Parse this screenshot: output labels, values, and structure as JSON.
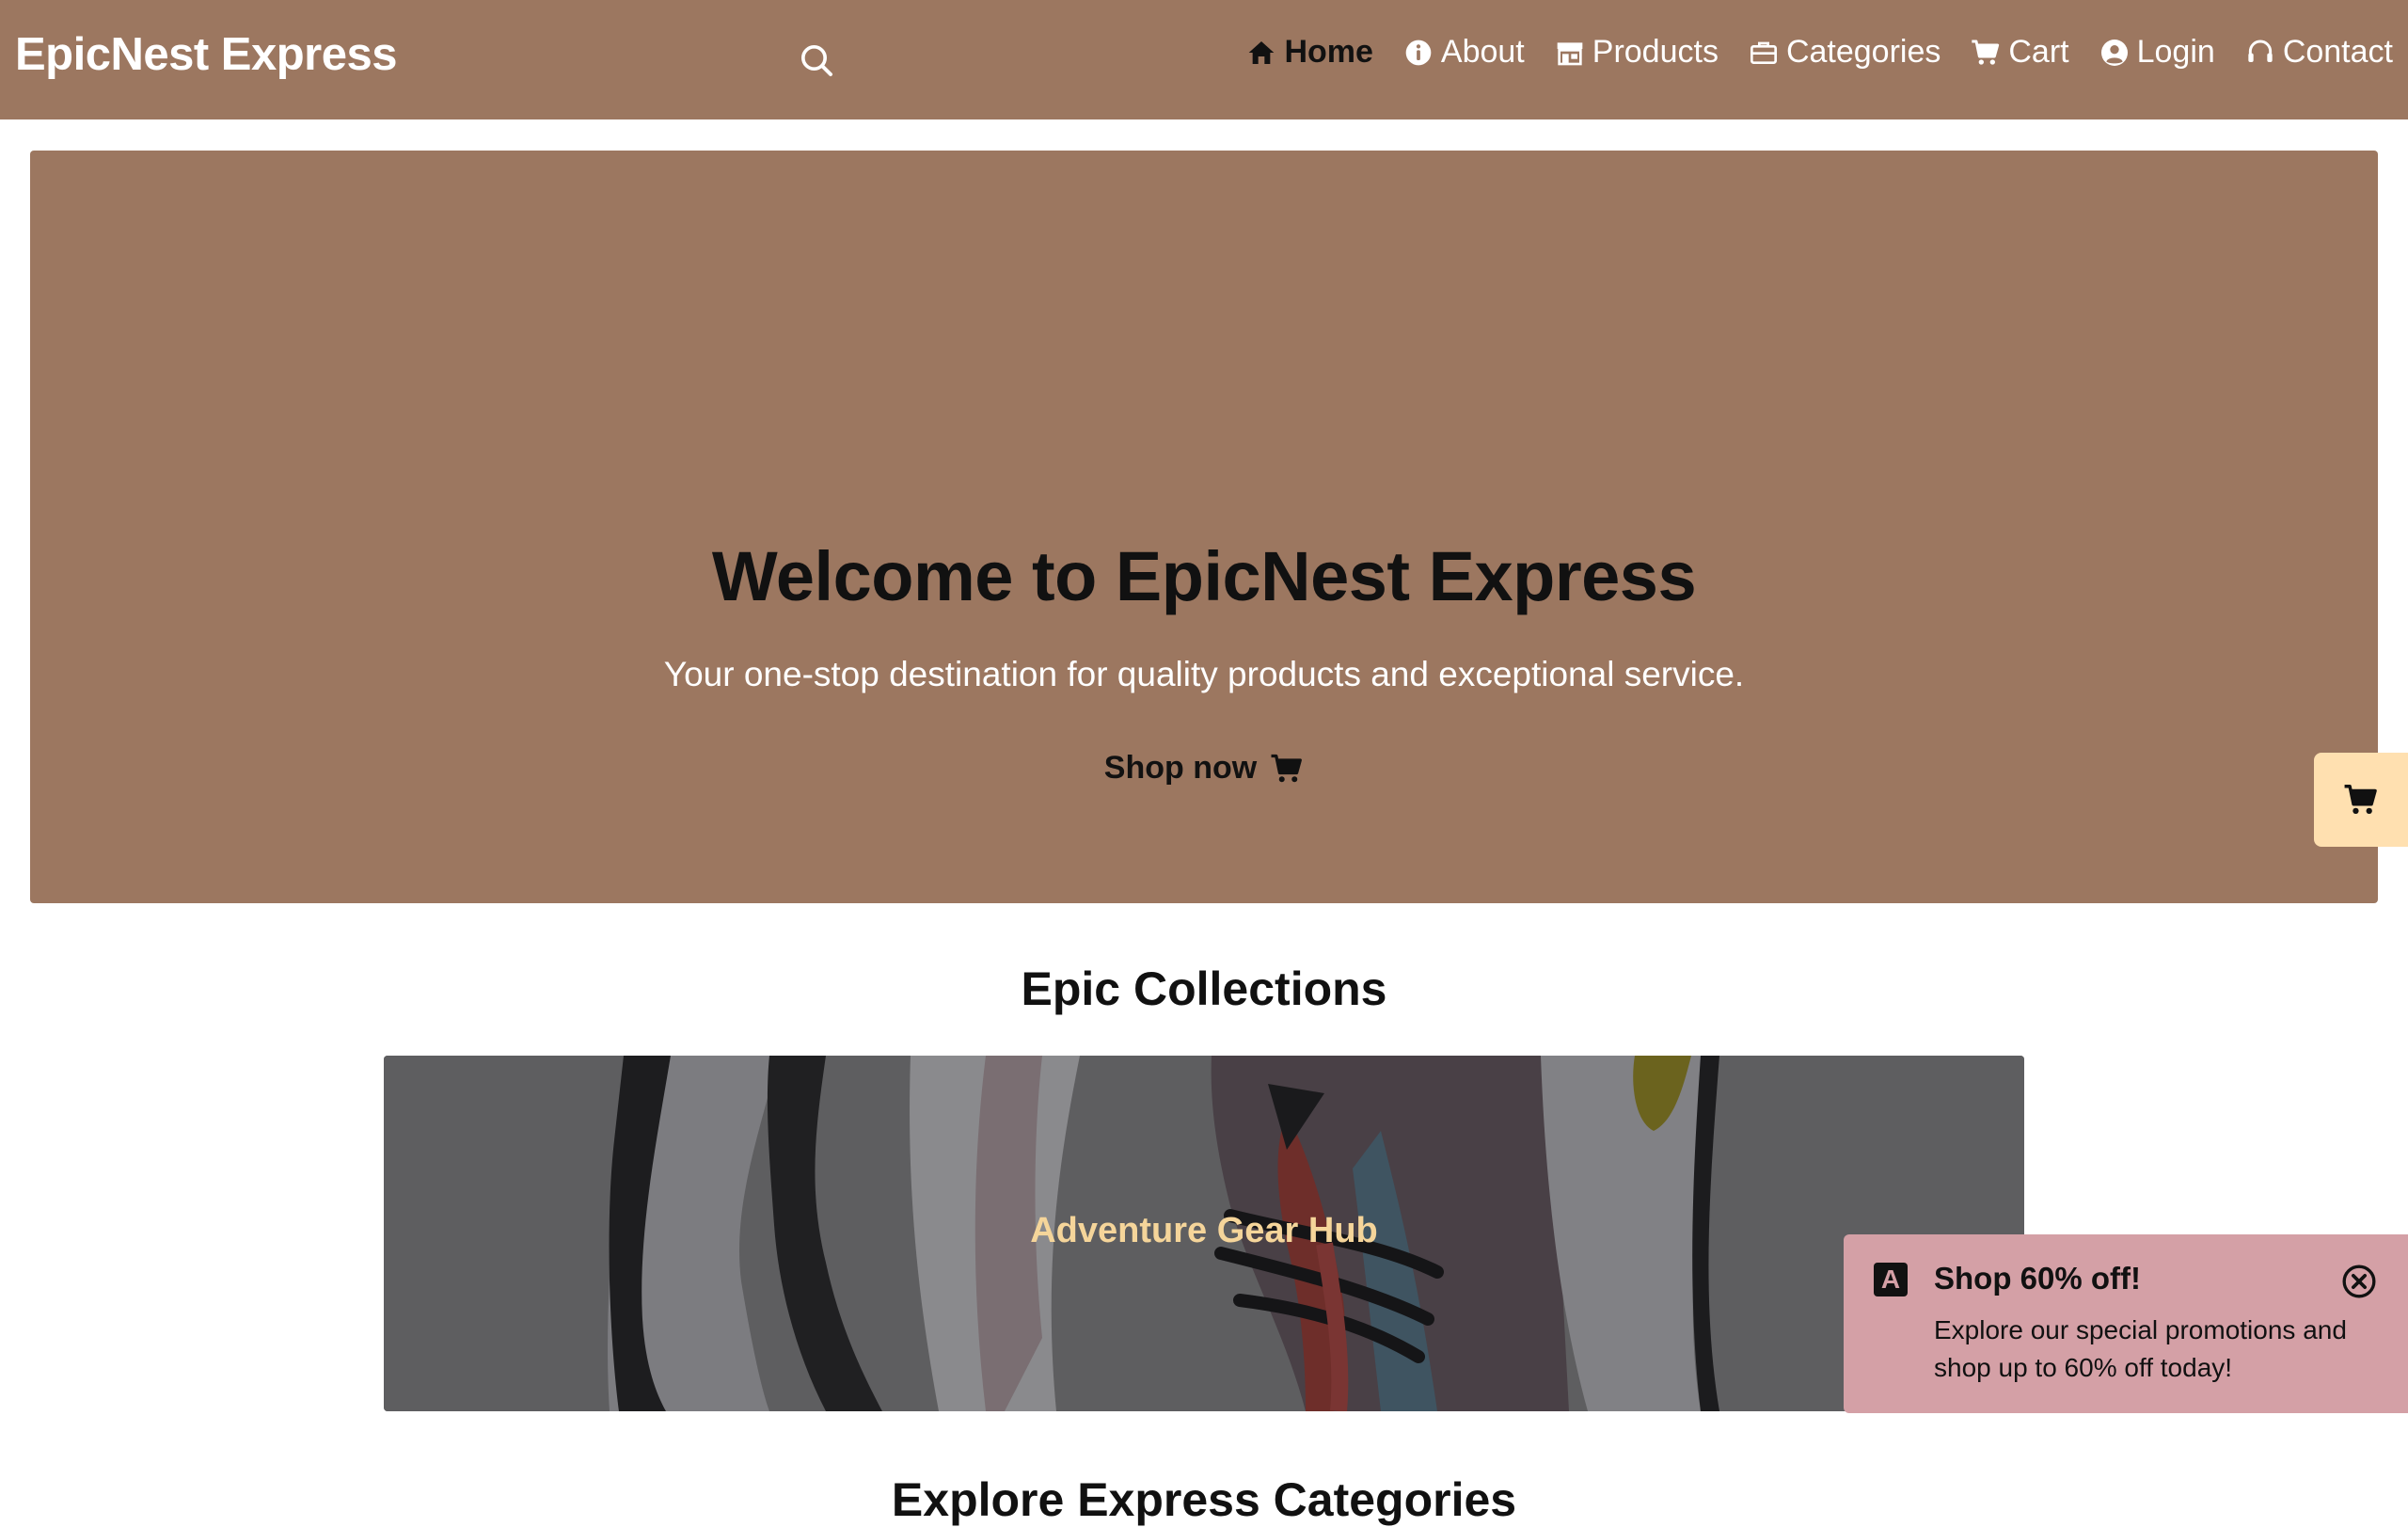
{
  "header": {
    "brand": "EpicNest Express",
    "search_icon": "search-icon",
    "nav": [
      {
        "label": "Home",
        "icon": "home-icon",
        "active": true
      },
      {
        "label": "About",
        "icon": "info-icon"
      },
      {
        "label": "Products",
        "icon": "store-icon"
      },
      {
        "label": "Categories",
        "icon": "briefcase-icon"
      },
      {
        "label": "Cart",
        "icon": "cart-icon"
      },
      {
        "label": "Login",
        "icon": "user-circle-icon"
      },
      {
        "label": "Contact",
        "icon": "headset-icon"
      }
    ]
  },
  "hero": {
    "title": "Welcome to EpicNest Express",
    "subtitle": "Your one-stop destination for quality products and exceptional service.",
    "cta_label": "Shop now",
    "cta_icon": "cart-icon"
  },
  "floating_cart": {
    "icon": "cart-icon"
  },
  "collections": {
    "title": "Epic Collections",
    "items": [
      {
        "label": "Adventure Gear Hub",
        "image": "sneaker-photo"
      }
    ]
  },
  "categories": {
    "title": "Explore Express Categories"
  },
  "promo_toast": {
    "logo_icon": "brand-a-icon",
    "logo_letter": "A",
    "title": "Shop 60% off!",
    "body": "Explore our special promotions and shop up to 60% off today!",
    "close_icon": "close-circle-icon"
  },
  "colors": {
    "brand_brown": "#9c7760",
    "toast_pink": "#d4a0a6",
    "cart_tab": "#ffe0b0",
    "collection_label": "#f5d59a"
  }
}
